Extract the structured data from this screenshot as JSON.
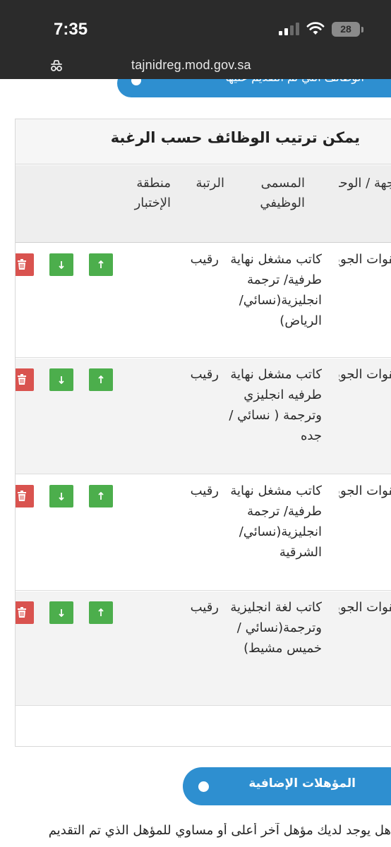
{
  "status_bar": {
    "time": "7:35",
    "battery": "28"
  },
  "browser": {
    "url": "tajnidreg.mod.gov.sa",
    "url_icon": "mask-icon"
  },
  "top_banner": {
    "label": "الوظائف التي تم التقديم عليها"
  },
  "jobs_card": {
    "title": "يمكن ترتيب الوظائف حسب الرغبة",
    "headers": {
      "unit": "الجهة / الوحدة",
      "job_title": "المسمى الوظيفي",
      "rank": "الرتبة",
      "region": "منطقة الإختبار"
    },
    "rows": [
      {
        "unit": "القوات الجوية الملكية السعودية",
        "job_title": "كاتب مشغل نهاية طرفية/ ترجمة انجليزية(نسائي/ الرياض)",
        "rank": "رقيب",
        "region": ""
      },
      {
        "unit": "القوات الجوية الملكية السعودية",
        "job_title": "كاتب مشغل نهاية طرفيه انجليزي وترجمة ( نسائي / جده",
        "rank": "رقيب",
        "region": ""
      },
      {
        "unit": "القوات الجوية الملكية السعودية",
        "job_title": "كاتب مشغل نهاية طرفية/ ترجمة انجليزية(نسائي/ الشرقية",
        "rank": "رقيب",
        "region": ""
      },
      {
        "unit": "القوات الجوية الملكية السعودية",
        "job_title": "كاتب لغة انجليزية وترجمة(نسائي /خميس مشيط)",
        "rank": "رقيب",
        "region": ""
      }
    ],
    "colors": {
      "move_button": "#4cae4c",
      "delete_button": "#d9534f"
    }
  },
  "additional_qualifications": {
    "label": "المؤهلات الإضافية",
    "question": "هل يوجد لديك مؤهل آخر أعلى أو مساوي للمؤهل الذي تم التقديم"
  },
  "accent_color": "#2e8fd0"
}
